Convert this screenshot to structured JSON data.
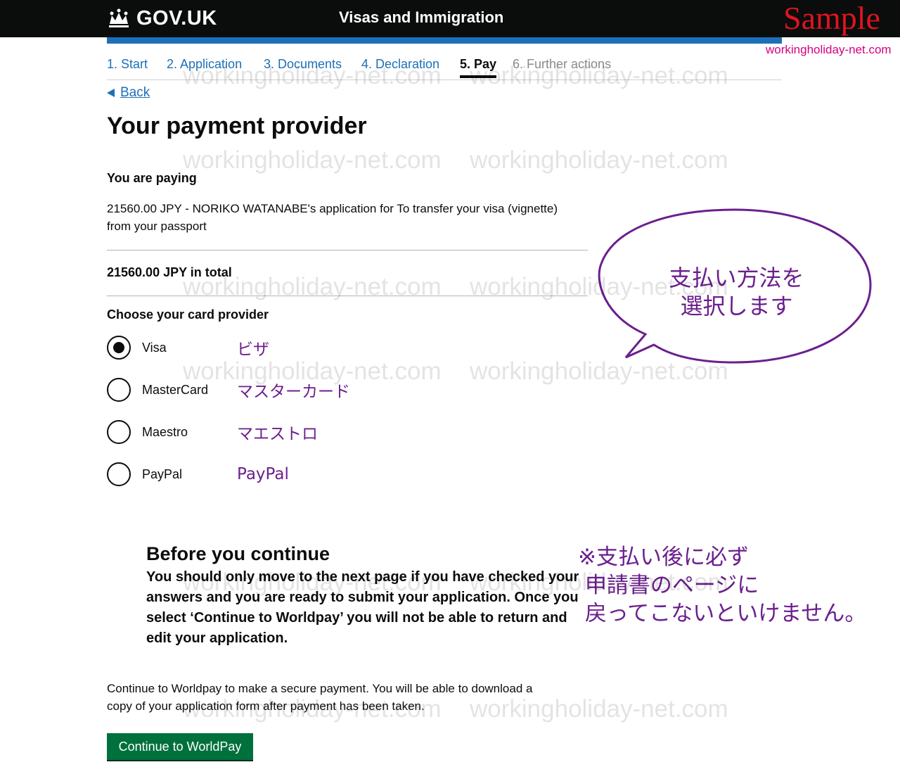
{
  "header": {
    "logo_text": "GOV.UK",
    "service_name": "Visas and Immigration",
    "sample_stamp": "Sample",
    "sample_url": "workingholiday-net.com"
  },
  "steps": [
    {
      "label": "1. Start",
      "state": "link"
    },
    {
      "label": "2. Application",
      "state": "link"
    },
    {
      "label": "3. Documents",
      "state": "link"
    },
    {
      "label": "4. Declaration",
      "state": "link"
    },
    {
      "label": "5. Pay",
      "state": "current"
    },
    {
      "label": "6. Further actions",
      "state": "disabled"
    }
  ],
  "back_label": "Back",
  "page_title": "Your payment provider",
  "paying": {
    "heading": "You are paying",
    "line1": "21560.00 JPY - NORIKO WATANABE's application for To transfer your visa (vignette)",
    "line2": "from your passport",
    "total": "21560.00 JPY in total"
  },
  "card_provider": {
    "heading": "Choose your card provider",
    "options": [
      {
        "label": "Visa",
        "note": "ビザ",
        "checked": true
      },
      {
        "label": "MasterCard",
        "note": "マスターカード",
        "checked": false
      },
      {
        "label": "Maestro",
        "note": "マエストロ",
        "checked": false
      },
      {
        "label": "PayPal",
        "note": "PayPal",
        "checked": false
      }
    ]
  },
  "callout": {
    "line1": "支払い方法を",
    "line2": "選択します"
  },
  "before_continue": {
    "heading": "Before you continue",
    "text": "You should only move to the next page if you have checked your answers and you are ready to submit your application. Once you select ‘Continue to Worldpay’ you will not be able to return and edit your application."
  },
  "note_jp": {
    "line1": "※支払い後に必ず",
    "line2": " 申請書のページに",
    "line3": " 戻ってこないといけません。"
  },
  "worldpay": {
    "line1": "Continue to Worldpay to make a secure payment. You will be able to download a",
    "line2": "copy of your application form after payment has been taken.",
    "button_label": "Continue to WorldPay"
  },
  "watermark": "workingholiday-net.com",
  "colors": {
    "header_bg": "#0b0c0c",
    "govuk_blue": "#1d70b8",
    "button_green": "#00703c",
    "annotation_purple": "#6b1f8e",
    "sample_red": "#e0141e"
  }
}
